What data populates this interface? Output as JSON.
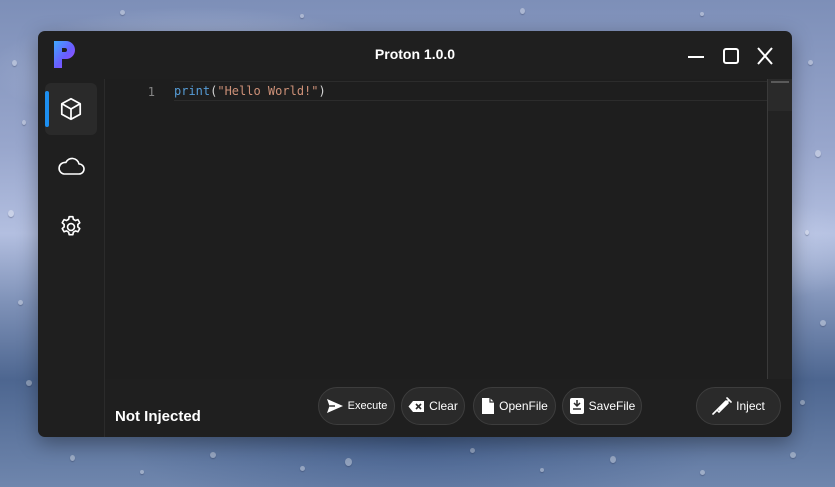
{
  "window": {
    "title": "Proton 1.0.0"
  },
  "app": {
    "logo": "proton-logo"
  },
  "titlebar": {
    "minimize": {
      "icon": "minimize-icon"
    },
    "maximize": {
      "icon": "maximize-icon"
    },
    "close": {
      "icon": "close-icon"
    }
  },
  "sidebar": {
    "items": [
      {
        "icon": "cube-icon",
        "active": true
      },
      {
        "icon": "cloud-icon",
        "active": false
      },
      {
        "icon": "gear-icon",
        "active": false
      }
    ],
    "accent": "#1d8ff0"
  },
  "editor": {
    "line_number": "1",
    "code": {
      "fn": "print",
      "open": "(",
      "string": "\"Hello World!\"",
      "close": ")"
    }
  },
  "status": {
    "text": "Not Injected"
  },
  "toolbar": {
    "execute": {
      "label": "Execute",
      "icon": "send-icon"
    },
    "clear": {
      "label": "Clear",
      "icon": "backspace-icon"
    },
    "open": {
      "label": "OpenFile",
      "icon": "file-icon"
    },
    "save": {
      "label": "SaveFile",
      "icon": "save-file-icon"
    },
    "inject": {
      "label": "Inject",
      "icon": "syringe-icon"
    }
  }
}
